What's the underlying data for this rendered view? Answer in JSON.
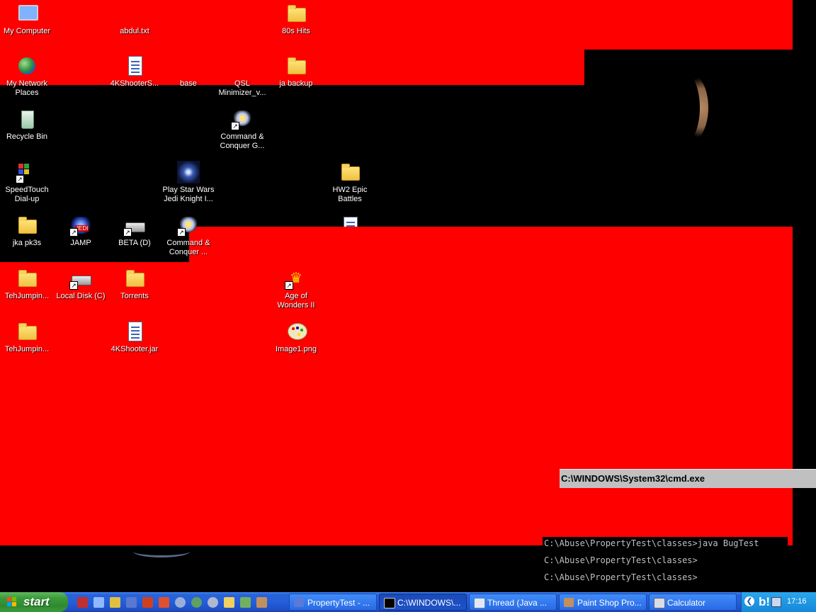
{
  "desktop": {
    "icons": [
      {
        "id": "my-computer",
        "label": "My Computer"
      },
      {
        "id": "abdul",
        "label": "abdul.txt"
      },
      {
        "id": "80s-hits",
        "label": "80s Hits"
      },
      {
        "id": "my-network",
        "label": "My Network Places"
      },
      {
        "id": "4kshooter-s",
        "label": "4KShooterS..."
      },
      {
        "id": "base",
        "label": "base"
      },
      {
        "id": "qsl",
        "label": "QSL Minimizer_v..."
      },
      {
        "id": "ja-backup",
        "label": "ja backup"
      },
      {
        "id": "recycle-bin",
        "label": "Recycle Bin"
      },
      {
        "id": "cnc-g",
        "label": "Command & Conquer G..."
      },
      {
        "id": "speedtouch",
        "label": "SpeedTouch Dial-up"
      },
      {
        "id": "star-wars",
        "label": "Play Star Wars Jedi Knight I..."
      },
      {
        "id": "hw2",
        "label": "HW2 Epic Battles"
      },
      {
        "id": "jka-pk3s",
        "label": "jka pk3s"
      },
      {
        "id": "jamp",
        "label": "JAMP"
      },
      {
        "id": "beta-d",
        "label": "BETA (D)"
      },
      {
        "id": "cnc-2",
        "label": "Command & Conquer ..."
      },
      {
        "id": "tehjumpin-1",
        "label": "TehJumpin..."
      },
      {
        "id": "local-disk",
        "label": "Local Disk (C)"
      },
      {
        "id": "torrents",
        "label": "Torrents"
      },
      {
        "id": "age-of-wonders",
        "label": "Age of Wonders II"
      },
      {
        "id": "tehjumpin-2",
        "label": "TehJumpin..."
      },
      {
        "id": "4kshooter-jar",
        "label": "4KShooter.jar"
      },
      {
        "id": "image1",
        "label": "Image1.png"
      }
    ]
  },
  "cmd": {
    "title": "C:\\WINDOWS\\System32\\cmd.exe",
    "lines": [
      "C:\\Abuse\\PropertyTest\\classes>java BugTest",
      "C:\\Abuse\\PropertyTest\\classes>",
      "C:\\Abuse\\PropertyTest\\classes>"
    ]
  },
  "taskbar": {
    "start_label": "start",
    "buttons": [
      {
        "label": "PropertyTest - ...",
        "active": false
      },
      {
        "label": "C:\\WINDOWS\\...",
        "active": true
      },
      {
        "label": "Thread (Java ...",
        "active": false
      },
      {
        "label": "Paint Shop Pro...",
        "active": false
      },
      {
        "label": "Calculator",
        "active": false
      }
    ],
    "tray": {
      "clock": "17:16",
      "yahoo": "b!"
    }
  },
  "colors": {
    "glitch_red": "#ff0000",
    "taskbar_blue": "#245edb",
    "start_green": "#3c9a3c",
    "tray_blue": "#1688d8"
  }
}
